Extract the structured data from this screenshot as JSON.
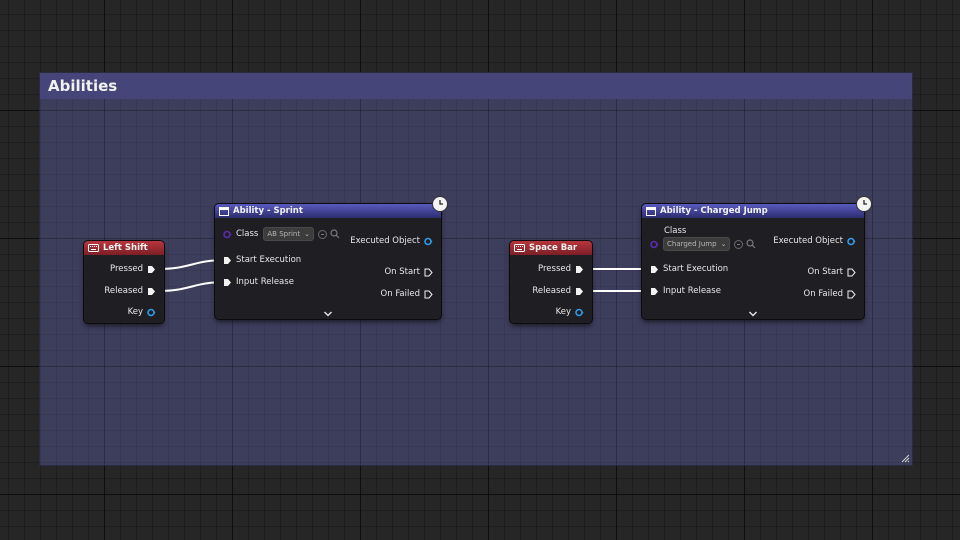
{
  "comment": {
    "title": "Abilities"
  },
  "nodes": {
    "left_shift": {
      "title": "Left Shift",
      "pins": {
        "pressed": "Pressed",
        "released": "Released",
        "key": "Key"
      }
    },
    "ability_sprint": {
      "title": "Ability - Sprint",
      "class_label": "Class",
      "class_value": "AB Sprint",
      "inputs": {
        "start_execution": "Start Execution",
        "input_release": "Input Release"
      },
      "outputs": {
        "executed_object": "Executed Object",
        "on_start": "On Start",
        "on_failed": "On Failed"
      }
    },
    "space_bar": {
      "title": "Space Bar",
      "pins": {
        "pressed": "Pressed",
        "released": "Released",
        "key": "Key"
      }
    },
    "ability_charged_jump": {
      "title": "Ability - Charged Jump",
      "class_label": "Class",
      "class_value": "Charged Jump",
      "inputs": {
        "start_execution": "Start Execution",
        "input_release": "Input Release"
      },
      "outputs": {
        "executed_object": "Executed Object",
        "on_start": "On Start",
        "on_failed": "On Failed"
      }
    }
  },
  "colors": {
    "event_header": "#b8363d",
    "function_header": "#5a5ac0",
    "struct_pin": "#2e9bea",
    "class_pin": "#5a2bb0",
    "exec_pin": "#f2f2f2"
  }
}
